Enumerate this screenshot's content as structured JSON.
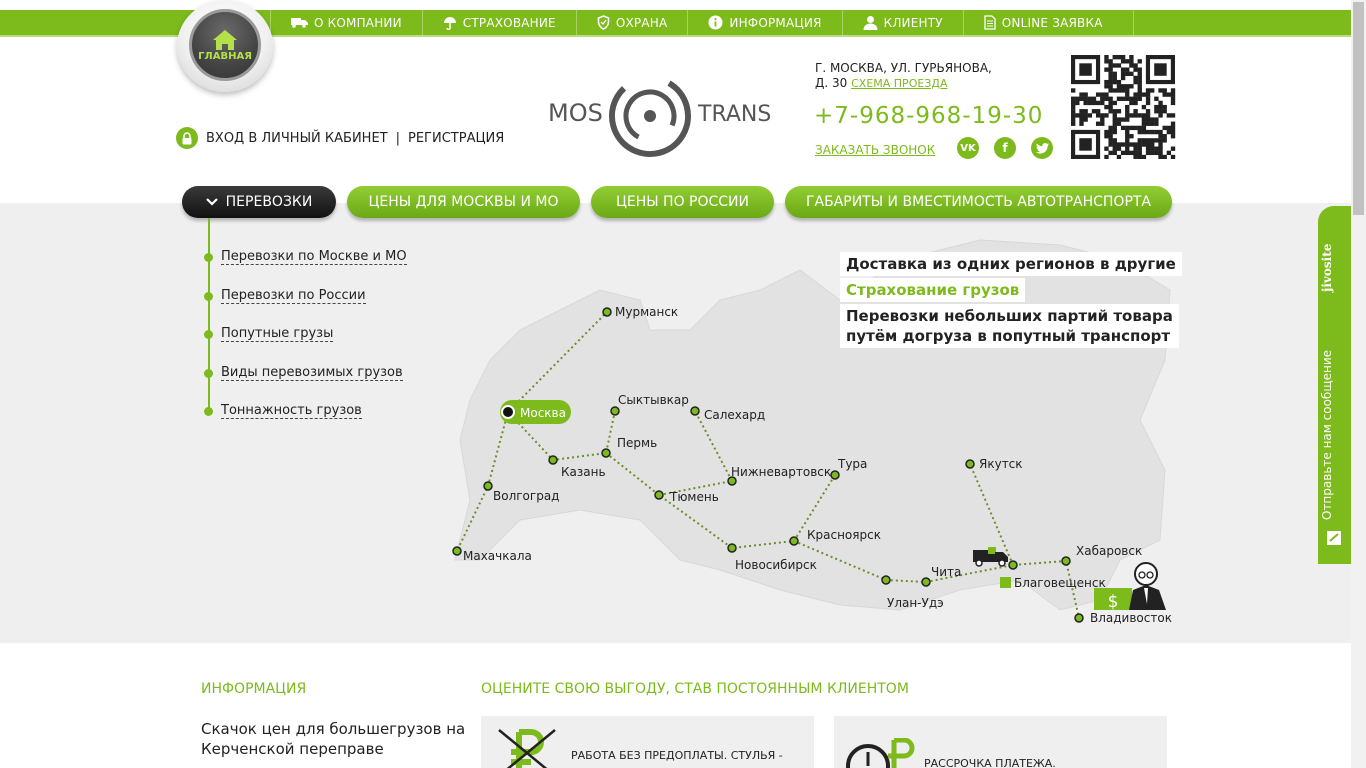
{
  "topmenu": [
    {
      "label": "О КОМПАНИИ",
      "icon": "truck-icon"
    },
    {
      "label": "СТРАХОВАНИЕ",
      "icon": "umbrella-icon"
    },
    {
      "label": "ОХРАНА",
      "icon": "shield-icon"
    },
    {
      "label": "ИНФОРМАЦИЯ",
      "icon": "info-icon"
    },
    {
      "label": "КЛИЕНТУ",
      "icon": "user-icon"
    },
    {
      "label": "ONLINE ЗАЯВКА",
      "icon": "document-icon"
    }
  ],
  "home": {
    "label": "ГЛАВНАЯ"
  },
  "login": {
    "enter": "ВХОД В ЛИЧНЫЙ КАБИНЕТ",
    "sep": "|",
    "register": "РЕГИСТРАЦИЯ"
  },
  "logo": {
    "left": "MOS",
    "right": "TRANS"
  },
  "contacts": {
    "address_line1": "Г. МОСКВА, УЛ. ГУРЬЯНОВА,",
    "address_line2": "Д. 30",
    "map_link": "СХЕМА ПРОЕЗДА",
    "phone": "+7-968-968-19-30",
    "callback": "ЗАКАЗАТЬ ЗВОНОК",
    "social": [
      "VK",
      "f",
      "twitter"
    ]
  },
  "tabs": [
    {
      "label": "ПЕРЕВОЗКИ",
      "active": true
    },
    {
      "label": "ЦЕНЫ ДЛЯ МОСКВЫ И МО"
    },
    {
      "label": "ЦЕНЫ ПО РОССИИ"
    },
    {
      "label": "ГАБАРИТЫ И ВМЕСТИМОСТЬ АВТОТРАНСПОРТА"
    }
  ],
  "submenu": [
    "Перевозки по Москве и МО",
    "Перевозки по России",
    "Попутные грузы",
    "Виды перевозимых грузов",
    "Тоннажность грузов"
  ],
  "promo": {
    "line1": "Доставка из одних регионов в другие",
    "line2": "Страхование грузов",
    "line3a": "Перевозки небольших партий товара",
    "line3b": "путём догруза в попутный транспорт"
  },
  "cities": {
    "murmansk": "Мурманск",
    "moscow": "Москва",
    "syktyvkar": "Сыктывкар",
    "salekhard": "Салехард",
    "perm": "Пермь",
    "kazan": "Казань",
    "volgograd": "Волгоград",
    "makhachkala": "Махачкала",
    "nizhnevartovsk": "Нижневартовск",
    "tura": "Тура",
    "tyumen": "Тюмень",
    "yakutsk": "Якутск",
    "krasnoyarsk": "Красноярск",
    "novosibirsk": "Новосибирск",
    "chita": "Чита",
    "ulanude": "Улан-Удэ",
    "khabarovsk": "Хабаровск",
    "blagoveshchensk": "Благовещенск",
    "vladivostok": "Владивосток"
  },
  "map_badge": "$",
  "jivo": {
    "logo": "jivosite",
    "text": "Отправьте нам сообщение"
  },
  "info": {
    "heading": "ИНФОРМАЦИЯ",
    "text": "Скачок цен для большегрузов на Керченской переправе"
  },
  "benefits": {
    "heading": "ОЦЕНИТЕ СВОЮ ВЫГОДУ, СТАВ ПОСТОЯННЫМ КЛИЕНТОМ",
    "card1": "РАБОТА БЕЗ ПРЕДОПЛАТЫ. СТУЛЬЯ -",
    "card2": "РАССРОЧКА ПЛАТЕЖА."
  },
  "colors": {
    "accent": "#7dba1c",
    "dark": "#222222",
    "map_bg": "#efefef"
  }
}
